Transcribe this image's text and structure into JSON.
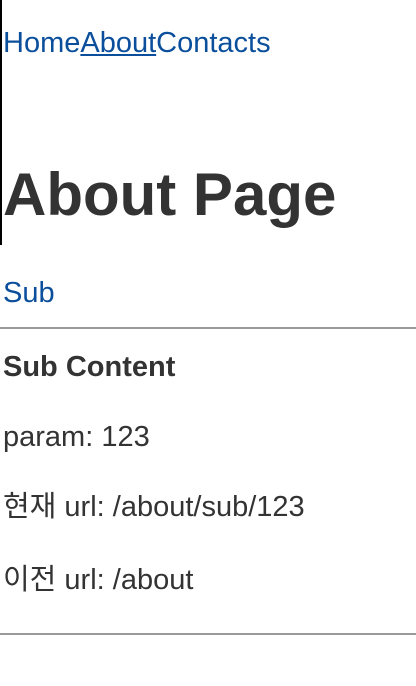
{
  "nav": {
    "items": [
      {
        "label": "Home"
      },
      {
        "label": "About"
      },
      {
        "label": "Contacts"
      }
    ]
  },
  "about": {
    "title": "About Page",
    "sub_link": "Sub"
  },
  "sub": {
    "title": "Sub Content",
    "param": "param: 123",
    "current_url": "현재 url: /about/sub/123",
    "previous_url": "이전 url: /about"
  },
  "colors": {
    "link": "#0b4f9c",
    "text": "#333333",
    "rule": "#9a9a9a"
  }
}
